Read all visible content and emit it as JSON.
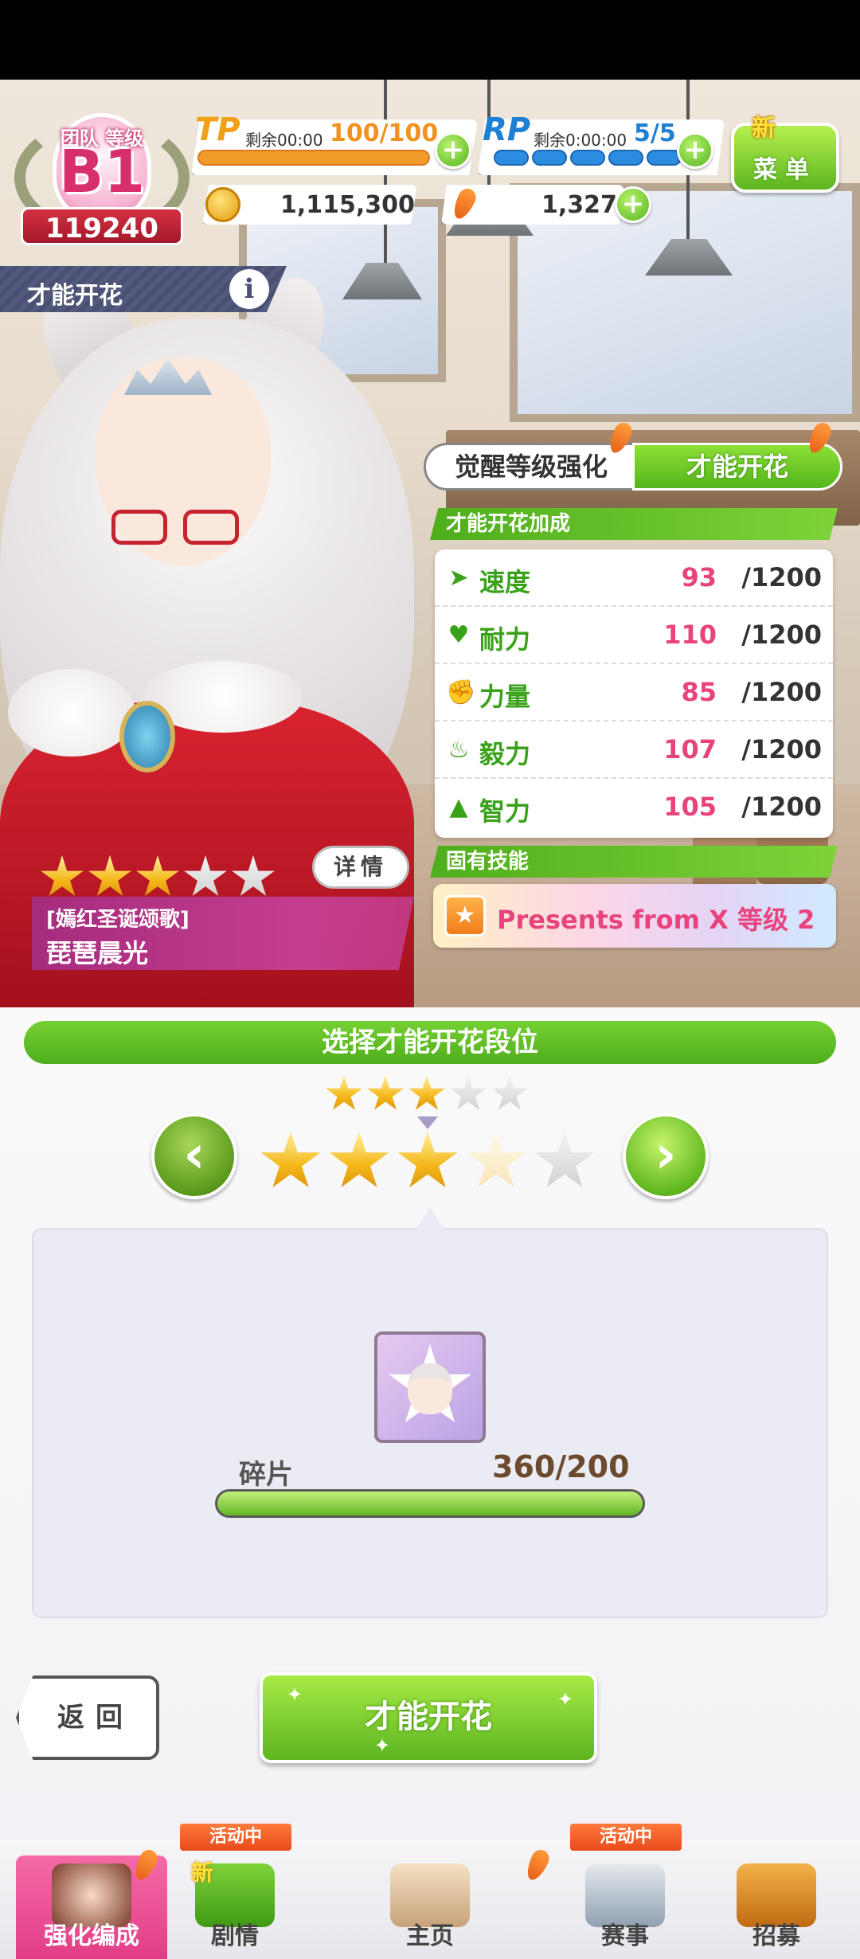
{
  "rank": {
    "label": "团队 等级",
    "grade": "B1",
    "score": "119240"
  },
  "tp": {
    "label": "TP",
    "remain": "剩余00:00",
    "value": "100/100"
  },
  "rp": {
    "label": "RP",
    "remain": "剩余0:00:00",
    "value": "5/5"
  },
  "menu": {
    "new_badge": "新",
    "label": "菜单"
  },
  "currency": {
    "coins": "1,115,300",
    "carats": "1,327"
  },
  "name_tab": {
    "label": "才能开花",
    "info": "i"
  },
  "tabs": [
    {
      "label": "觉醒等级强化"
    },
    {
      "label": "才能开花"
    }
  ],
  "sections": {
    "bonus": "才能开花加成",
    "unique_skill": "固有技能"
  },
  "stats": [
    {
      "icon": "speed-icon",
      "name": "速度",
      "value": "93",
      "max": "/1200"
    },
    {
      "icon": "stamina-icon",
      "name": "耐力",
      "value": "110",
      "max": "/1200"
    },
    {
      "icon": "power-icon",
      "name": "力量",
      "value": "85",
      "max": "/1200"
    },
    {
      "icon": "guts-icon",
      "name": "毅力",
      "value": "107",
      "max": "/1200"
    },
    {
      "icon": "wit-icon",
      "name": "智力",
      "value": "105",
      "max": "/1200"
    }
  ],
  "skill": {
    "name": "Presents from X  等级 2"
  },
  "character": {
    "title": "[嫣红圣诞颂歌]",
    "name": "琵琶晨光",
    "stars": 3,
    "max_stars": 5,
    "detail_label": "详情"
  },
  "select": {
    "header": "选择才能开花段位",
    "current_stars": 3,
    "target_stars": 3,
    "total_stars": 5
  },
  "fragments": {
    "label": "碎片",
    "value": "360/200",
    "fill": 1.0
  },
  "buttons": {
    "back": "返回",
    "bloom": "才能开花"
  },
  "bottom_nav": [
    {
      "label": "强化编成",
      "active": true,
      "tag": ""
    },
    {
      "label": "剧情",
      "active": false,
      "tag": "活动中",
      "new": "新"
    },
    {
      "label": "主页",
      "active": false,
      "tag": ""
    },
    {
      "label": "赛事",
      "active": false,
      "tag": "活动中"
    },
    {
      "label": "招募",
      "active": false,
      "tag": ""
    }
  ],
  "colors": {
    "accent_green": "#5cb521",
    "pink": "#e8437d",
    "stat_green": "#3aa21a"
  }
}
